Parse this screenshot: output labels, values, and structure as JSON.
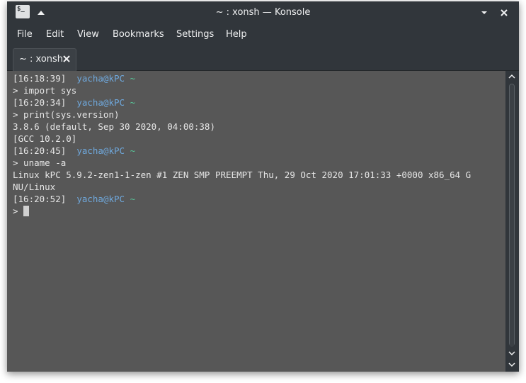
{
  "window": {
    "title": "~ : xonsh — Konsole",
    "app_icon_text": "$_"
  },
  "menubar": {
    "items": [
      "File",
      "Edit",
      "View",
      "Bookmarks",
      "Settings",
      "Help"
    ]
  },
  "tabs": [
    {
      "label": "~ : xonsh"
    }
  ],
  "terminal": {
    "lines": [
      {
        "time": "[16:18:39]",
        "user": "yacha@kPC",
        "dir": "~"
      },
      {
        "text": "> import sys"
      },
      {
        "time": "[16:20:34]",
        "user": "yacha@kPC",
        "dir": "~"
      },
      {
        "text": "> print(sys.version)"
      },
      {
        "text": "3.8.6 (default, Sep 30 2020, 04:00:38)"
      },
      {
        "text": "[GCC 10.2.0]"
      },
      {
        "time": "[16:20:45]",
        "user": "yacha@kPC",
        "dir": "~"
      },
      {
        "text": "> uname -a"
      },
      {
        "text": "Linux kPC 5.9.2-zen1-1-zen #1 ZEN SMP PREEMPT Thu, 29 Oct 2020 17:01:33 +0000 x86_64 G"
      },
      {
        "text": "NU/Linux"
      },
      {
        "time": "[16:20:52]",
        "user": "yacha@kPC",
        "dir": "~"
      },
      {
        "text": "> "
      }
    ]
  },
  "colors": {
    "chrome": "#31363b",
    "terminal_bg": "#575757",
    "prompt_user": "#6fa8dc",
    "prompt_dir": "#58c99a"
  }
}
